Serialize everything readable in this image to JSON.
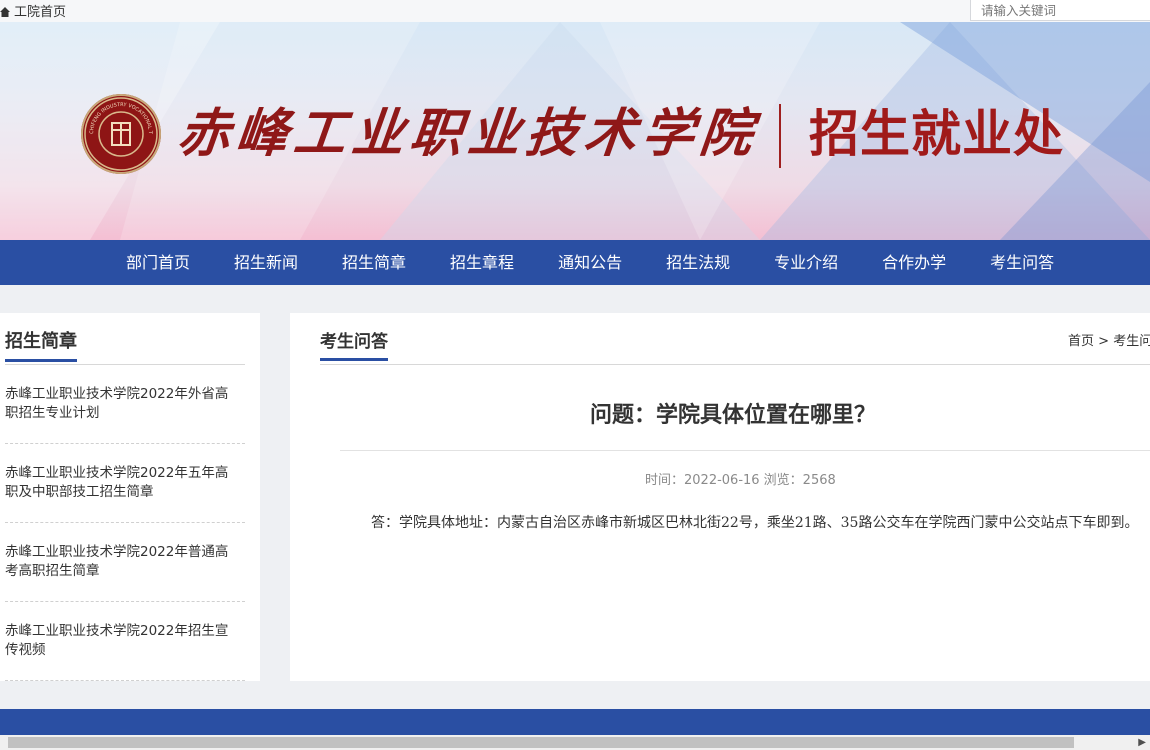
{
  "topbar": {
    "home_label": "工院首页",
    "search_placeholder": "请输入关键词"
  },
  "banner": {
    "school_name": "赤峰工业职业技术学院",
    "office_name": "招生就业处",
    "seal_text": "CHIFENG INDUSTRY VOCATIONAL TECHNOLOGY COLLEGE"
  },
  "nav": {
    "items": [
      "部门首页",
      "招生新闻",
      "招生简章",
      "招生章程",
      "通知公告",
      "招生法规",
      "专业介绍",
      "合作办学",
      "考生问答"
    ]
  },
  "sidebar": {
    "title": "招生简章",
    "items": [
      "赤峰工业职业技术学院2022年外省高职招生专业计划",
      "赤峰工业职业技术学院2022年五年高职及中职部技工招生简章",
      "赤峰工业职业技术学院2022年普通高考高职招生简章",
      "赤峰工业职业技术学院2022年招生宣传视频"
    ]
  },
  "main": {
    "title": "考生问答",
    "breadcrumb": [
      "首页",
      ">",
      "考生问答"
    ],
    "question": "问题：学院具体位置在哪里？",
    "meta": "时间：2022-06-16 浏览：2568",
    "answer": "答：学院具体地址：内蒙古自治区赤峰市新城区巴林北街22号，乘坐21路、35路公交车在学院西门蒙中公交站点下车即到。"
  },
  "colors": {
    "nav_blue": "#2a4fa3",
    "brand_red": "#a01a1a"
  }
}
